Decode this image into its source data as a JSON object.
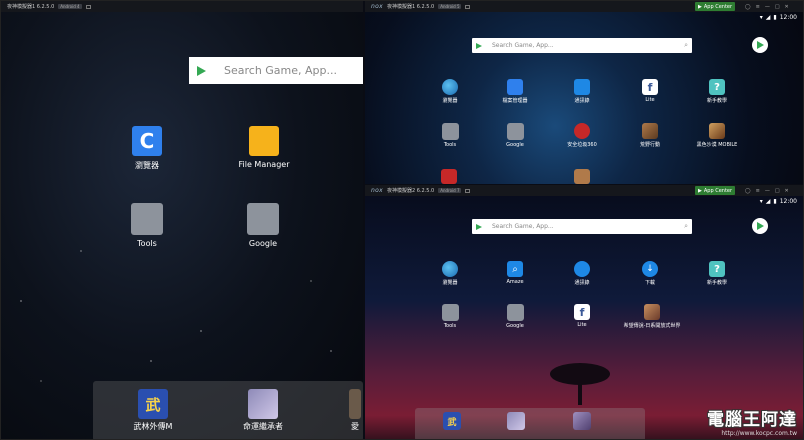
{
  "win1": {
    "title": "夜神模擬器1 6.2.5.0",
    "android": "Android 4",
    "search_placeholder": "Search Game, App...",
    "icons": [
      {
        "label": "瀏覽器"
      },
      {
        "label": "File Manager"
      },
      {
        "label": "Tools"
      },
      {
        "label": "Google"
      }
    ],
    "dock": [
      {
        "label": "武林外傳M"
      },
      {
        "label": "命運繼承者"
      },
      {
        "label": "愛"
      }
    ]
  },
  "win2": {
    "logo": "nox",
    "title": "夜神模擬器1 6.2.5.0",
    "android": "Android 5",
    "app_center": "App Center",
    "clock": "12:00",
    "search_placeholder": "Search Game, App...",
    "icons": [
      {
        "label": "瀏覽器"
      },
      {
        "label": "檔案管理器"
      },
      {
        "label": "通訊錄"
      },
      {
        "label": "Lite"
      },
      {
        "label": "新手教學"
      },
      {
        "label": "Tools"
      },
      {
        "label": "Google"
      },
      {
        "label": "安全垃圾360"
      },
      {
        "label": "荒野行動"
      },
      {
        "label": "黑色沙漠 MOBILE"
      }
    ]
  },
  "win3": {
    "logo": "nox",
    "title": "夜神模擬器2 6.2.5.0",
    "android": "Android 7",
    "app_center": "App Center",
    "clock": "12:00",
    "search_placeholder": "Search Game, App...",
    "icons": [
      {
        "label": "瀏覽器"
      },
      {
        "label": "Amaze"
      },
      {
        "label": "通訊錄"
      },
      {
        "label": "下載"
      },
      {
        "label": "新手教學"
      },
      {
        "label": "Tools"
      },
      {
        "label": "Google"
      },
      {
        "label": "Lite"
      },
      {
        "label": "希望傳說-日系開放式世界"
      }
    ]
  },
  "watermark": {
    "main": "電腦王阿達",
    "url": "http://www.kocpc.com.tw"
  },
  "colors": {
    "play_green": "#34a853",
    "app_center": "#2e7d32",
    "folder": "#8d939c",
    "browser_blue": "#2f80ed",
    "file_yellow": "#f6b21b"
  }
}
